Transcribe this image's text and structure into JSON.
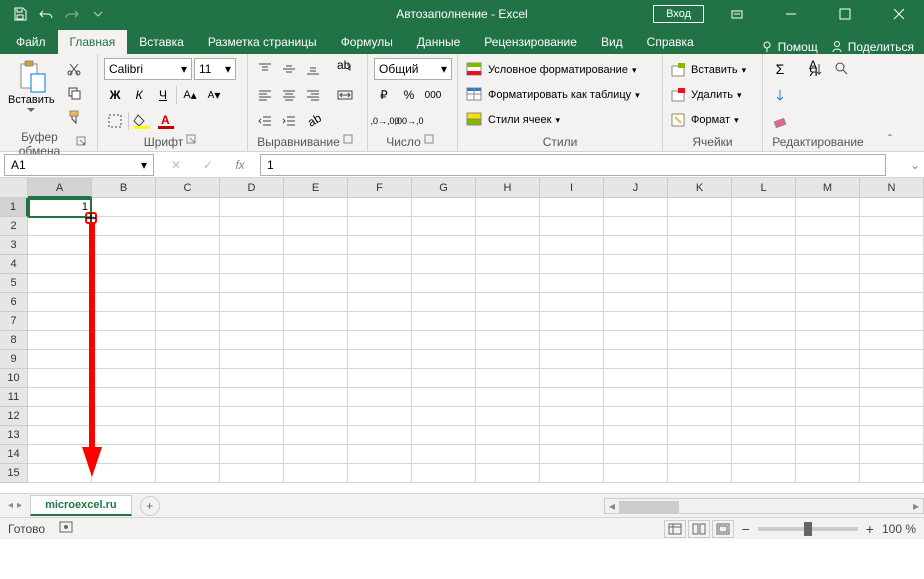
{
  "title": "Автозаполнение  -  Excel",
  "login": "Вход",
  "tabs": [
    "Файл",
    "Главная",
    "Вставка",
    "Разметка страницы",
    "Формулы",
    "Данные",
    "Рецензирование",
    "Вид",
    "Справка"
  ],
  "active_tab": 1,
  "tell_me": "Помощ",
  "share": "Поделиться",
  "ribbon": {
    "clipboard": {
      "label": "Буфер обмена",
      "paste": "Вставить"
    },
    "font": {
      "label": "Шрифт",
      "name": "Calibri",
      "size": "11"
    },
    "alignment": {
      "label": "Выравнивание"
    },
    "number": {
      "label": "Число",
      "format": "Общий"
    },
    "styles": {
      "label": "Стили",
      "cond": "Условное форматирование",
      "table": "Форматировать как таблицу",
      "cell": "Стили ячеек"
    },
    "cells": {
      "label": "Ячейки",
      "insert": "Вставить",
      "delete": "Удалить",
      "format": "Формат"
    },
    "editing": {
      "label": "Редактирование"
    }
  },
  "namebox": "A1",
  "formula": "1",
  "columns": [
    "A",
    "B",
    "C",
    "D",
    "E",
    "F",
    "G",
    "H",
    "I",
    "J",
    "K",
    "L",
    "M",
    "N"
  ],
  "rows": [
    1,
    2,
    3,
    4,
    5,
    6,
    7,
    8,
    9,
    10,
    11,
    12,
    13,
    14,
    15
  ],
  "cell_A1": "1",
  "sheet_name": "microexcel.ru",
  "status": "Готово",
  "zoom_minus": "−",
  "zoom_plus": "+",
  "zoom": "100 %"
}
